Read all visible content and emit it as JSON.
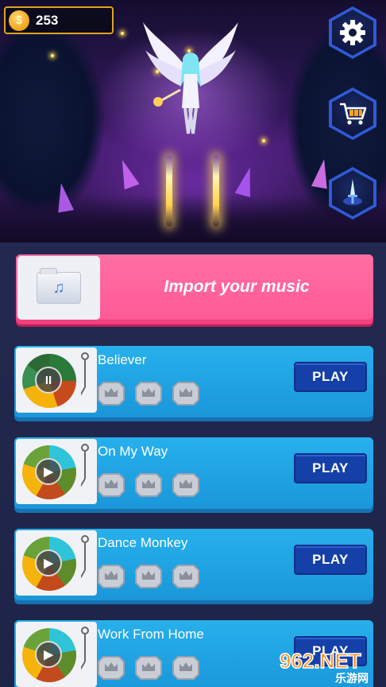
{
  "currency": {
    "coins": "253",
    "coin_symbol": "$"
  },
  "side_buttons": [
    {
      "name": "settings",
      "icon": "gear-icon"
    },
    {
      "name": "shop",
      "icon": "cart-icon"
    },
    {
      "name": "character",
      "icon": "sword-icon"
    }
  ],
  "import": {
    "label": "Import your music",
    "icon": "music-folder-icon"
  },
  "songs": [
    {
      "title": "Believer",
      "state": "paused",
      "control": "II",
      "play_label": "PLAY",
      "crowns": 3
    },
    {
      "title": "On My Way",
      "state": "stopped",
      "control": "▶",
      "play_label": "PLAY",
      "crowns": 3
    },
    {
      "title": "Dance Monkey",
      "state": "stopped",
      "control": "▶",
      "play_label": "PLAY",
      "crowns": 3
    },
    {
      "title": "Work From Home",
      "state": "stopped",
      "control": "▶",
      "play_label": "PLAY",
      "crowns": 3
    }
  ],
  "watermark": {
    "text": "962.NET",
    "subtext": "乐游网"
  },
  "colors": {
    "import_pink": "#ff5b96",
    "card_blue": "#1a98db",
    "play_blue": "#1440a8",
    "coin_border": "#e0a31f"
  }
}
